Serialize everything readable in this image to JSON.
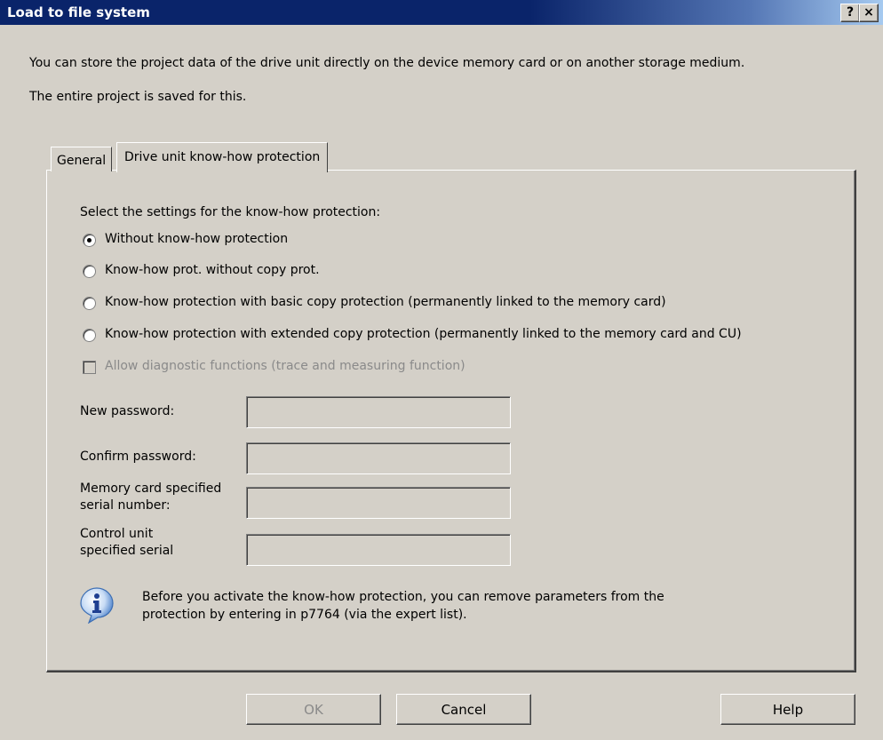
{
  "window": {
    "title": "Load to file system",
    "help_button": "?",
    "close_button": "×"
  },
  "intro": {
    "line1": "You can store the project data of the drive unit directly on the device memory card or on another storage medium.",
    "line2": "The entire project is saved for this."
  },
  "tabs": [
    {
      "label": "General",
      "active": false
    },
    {
      "label": "Drive unit know-how protection",
      "active": true
    }
  ],
  "panel": {
    "heading": "Select the settings for the know-how protection:",
    "radios": [
      {
        "label": "Without know-how protection",
        "checked": true
      },
      {
        "label": "Know-how prot. without copy prot.",
        "checked": false
      },
      {
        "label": "Know-how protection with basic copy protection (permanently linked to the memory card)",
        "checked": false
      },
      {
        "label": "Know-how protection with extended copy protection (permanently linked to the memory card and CU)",
        "checked": false
      }
    ],
    "diagnostic_checkbox": {
      "label": "Allow diagnostic functions (trace and measuring function)",
      "checked": false,
      "enabled": false
    },
    "fields": {
      "new_password_label": "New password:",
      "new_password_value": "",
      "confirm_password_label": "Confirm password:",
      "confirm_password_value": "",
      "memory_card_label_1": "Memory card specified",
      "memory_card_label_2": "serial number:",
      "memory_card_value": "",
      "control_unit_label_1": "Control unit",
      "control_unit_label_2": "specified serial",
      "control_unit_value": ""
    },
    "info": {
      "icon": "info-icon",
      "line1": "Before you activate the know-how protection, you can remove parameters from the",
      "line2": "protection by entering in p7764 (via the expert list)."
    }
  },
  "buttons": {
    "ok": "OK",
    "cancel": "Cancel",
    "help": "Help"
  }
}
